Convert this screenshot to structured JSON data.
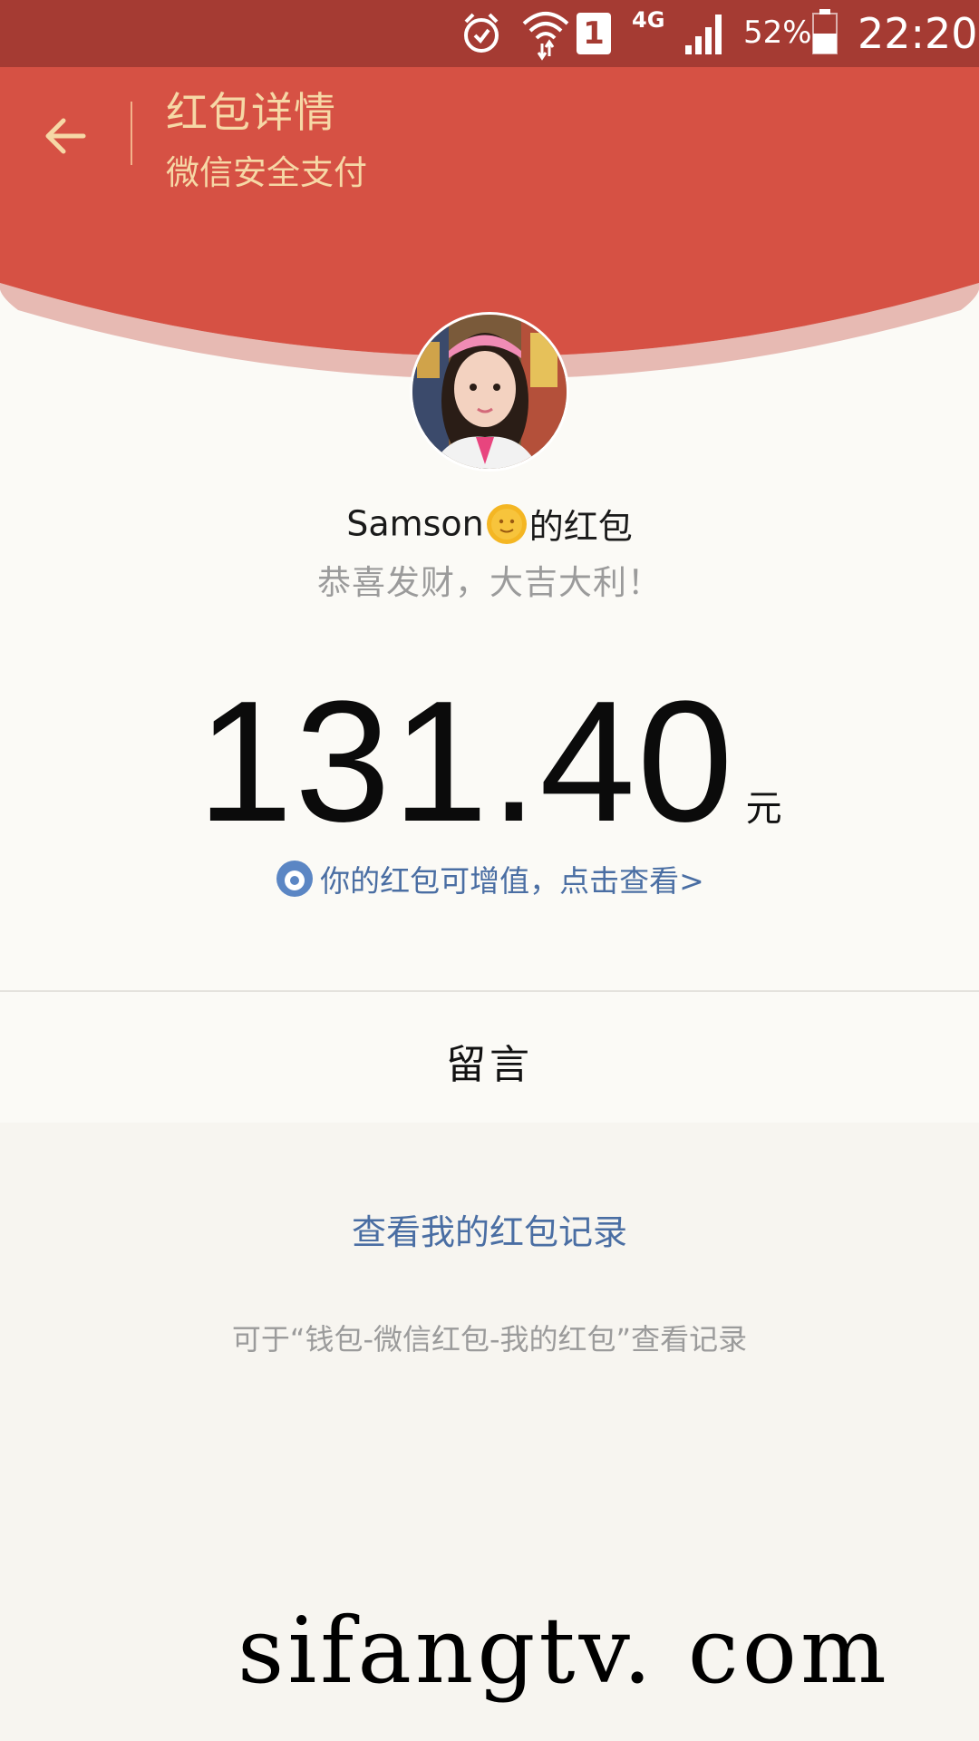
{
  "status_bar": {
    "network": "4G",
    "sim_slot": "1",
    "battery": "52%",
    "time": "22:20",
    "icons": [
      "alarm-icon",
      "wifi-icon",
      "sim-icon",
      "signal-icon",
      "battery-icon"
    ]
  },
  "header": {
    "title": "红包详情",
    "subtitle": "微信安全支付",
    "back_icon": "arrow-left-icon",
    "color": "#d65144",
    "text_color": "#f6d8a6"
  },
  "packet": {
    "sender_name": "Samson",
    "sender_suffix": "的红包",
    "blessing": "恭喜发财，大吉大利！",
    "amount": "131.40",
    "unit": "元",
    "upsell_text": "你的红包可增值，点击查看>"
  },
  "message": {
    "label": "留言"
  },
  "footer": {
    "record_link": "查看我的红包记录",
    "record_hint": "可于“钱包-微信红包-我的红包”查看记录"
  },
  "watermark": {
    "text": "sifangtv. com"
  },
  "colors": {
    "status_bar": "#a53b33",
    "link": "#4a6ea3",
    "muted": "#9b9b9b"
  }
}
